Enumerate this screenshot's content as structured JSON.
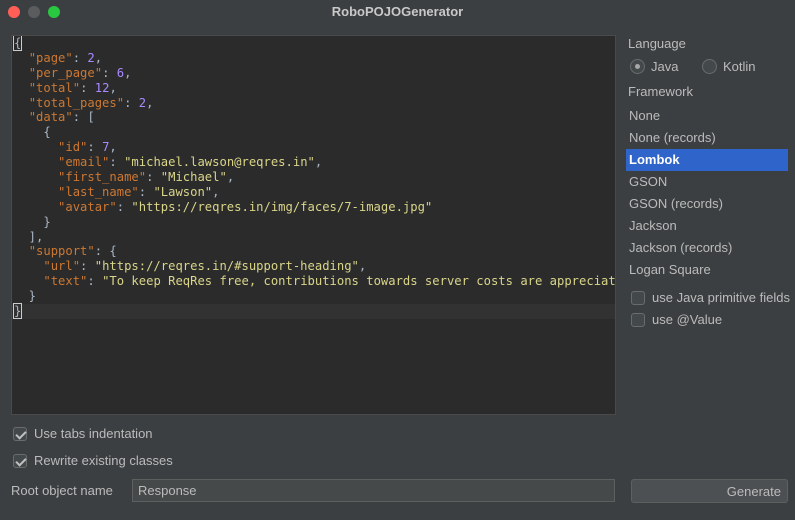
{
  "window": {
    "title": "RoboPOJOGenerator"
  },
  "editor": {
    "lines": [
      [
        {
          "t": "{",
          "c": "p"
        }
      ],
      [
        {
          "t": "  ",
          "c": "p"
        },
        {
          "t": "\"page\"",
          "c": "k"
        },
        {
          "t": ": ",
          "c": "p"
        },
        {
          "t": "2",
          "c": "n"
        },
        {
          "t": ",",
          "c": "p"
        }
      ],
      [
        {
          "t": "  ",
          "c": "p"
        },
        {
          "t": "\"per_page\"",
          "c": "k"
        },
        {
          "t": ": ",
          "c": "p"
        },
        {
          "t": "6",
          "c": "n"
        },
        {
          "t": ",",
          "c": "p"
        }
      ],
      [
        {
          "t": "  ",
          "c": "p"
        },
        {
          "t": "\"total\"",
          "c": "k"
        },
        {
          "t": ": ",
          "c": "p"
        },
        {
          "t": "12",
          "c": "n"
        },
        {
          "t": ",",
          "c": "p"
        }
      ],
      [
        {
          "t": "  ",
          "c": "p"
        },
        {
          "t": "\"total_pages\"",
          "c": "k"
        },
        {
          "t": ": ",
          "c": "p"
        },
        {
          "t": "2",
          "c": "n"
        },
        {
          "t": ",",
          "c": "p"
        }
      ],
      [
        {
          "t": "  ",
          "c": "p"
        },
        {
          "t": "\"data\"",
          "c": "k"
        },
        {
          "t": ": [",
          "c": "p"
        }
      ],
      [
        {
          "t": "    {",
          "c": "p"
        }
      ],
      [
        {
          "t": "      ",
          "c": "p"
        },
        {
          "t": "\"id\"",
          "c": "k"
        },
        {
          "t": ": ",
          "c": "p"
        },
        {
          "t": "7",
          "c": "n"
        },
        {
          "t": ",",
          "c": "p"
        }
      ],
      [
        {
          "t": "      ",
          "c": "p"
        },
        {
          "t": "\"email\"",
          "c": "k"
        },
        {
          "t": ": ",
          "c": "p"
        },
        {
          "t": "\"michael.lawson@reqres.in\"",
          "c": "s"
        },
        {
          "t": ",",
          "c": "p"
        }
      ],
      [
        {
          "t": "      ",
          "c": "p"
        },
        {
          "t": "\"first_name\"",
          "c": "k"
        },
        {
          "t": ": ",
          "c": "p"
        },
        {
          "t": "\"Michael\"",
          "c": "s"
        },
        {
          "t": ",",
          "c": "p"
        }
      ],
      [
        {
          "t": "      ",
          "c": "p"
        },
        {
          "t": "\"last_name\"",
          "c": "k"
        },
        {
          "t": ": ",
          "c": "p"
        },
        {
          "t": "\"Lawson\"",
          "c": "s"
        },
        {
          "t": ",",
          "c": "p"
        }
      ],
      [
        {
          "t": "      ",
          "c": "p"
        },
        {
          "t": "\"avatar\"",
          "c": "k"
        },
        {
          "t": ": ",
          "c": "p"
        },
        {
          "t": "\"https://reqres.in/img/faces/7-image.jpg\"",
          "c": "s"
        }
      ],
      [
        {
          "t": "    }",
          "c": "p"
        }
      ],
      [
        {
          "t": "  ],",
          "c": "p"
        }
      ],
      [
        {
          "t": "  ",
          "c": "p"
        },
        {
          "t": "\"support\"",
          "c": "k"
        },
        {
          "t": ": {",
          "c": "p"
        }
      ],
      [
        {
          "t": "    ",
          "c": "p"
        },
        {
          "t": "\"url\"",
          "c": "k"
        },
        {
          "t": ": ",
          "c": "p"
        },
        {
          "t": "\"https://reqres.in/#support-heading\"",
          "c": "s"
        },
        {
          "t": ",",
          "c": "p"
        }
      ],
      [
        {
          "t": "    ",
          "c": "p"
        },
        {
          "t": "\"text\"",
          "c": "k"
        },
        {
          "t": ": ",
          "c": "p"
        },
        {
          "t": "\"To keep ReqRes free, contributions towards server costs are appreciated!\"",
          "c": "s"
        }
      ],
      [
        {
          "t": "  }",
          "c": "p"
        }
      ],
      [
        {
          "t": "}",
          "c": "p"
        }
      ]
    ],
    "current_line": 18
  },
  "options": {
    "language_label": "Language",
    "languages": [
      {
        "label": "Java",
        "selected": true
      },
      {
        "label": "Kotlin",
        "selected": false
      }
    ],
    "framework_label": "Framework",
    "frameworks": [
      {
        "label": "None",
        "selected": false
      },
      {
        "label": "None (records)",
        "selected": false
      },
      {
        "label": "Lombok",
        "selected": true
      },
      {
        "label": "GSON",
        "selected": false
      },
      {
        "label": "GSON (records)",
        "selected": false
      },
      {
        "label": "Jackson",
        "selected": false
      },
      {
        "label": "Jackson (records)",
        "selected": false
      },
      {
        "label": "Logan Square",
        "selected": false
      }
    ],
    "use_primitive_label": "use Java primitive fields",
    "use_primitive_checked": false,
    "use_value_label": "use @Value",
    "use_value_checked": false
  },
  "bottom": {
    "tabs_indentation_label": "Use tabs indentation",
    "tabs_indentation_checked": true,
    "rewrite_label": "Rewrite existing classes",
    "rewrite_checked": true,
    "root_object_label": "Root object name",
    "root_object_value": "Response",
    "generate_label": "Generate"
  },
  "colors": {
    "selection": "#2f65ca",
    "json_key": "#cc7832",
    "json_string": "#d9d58a",
    "json_number": "#a889ff"
  }
}
